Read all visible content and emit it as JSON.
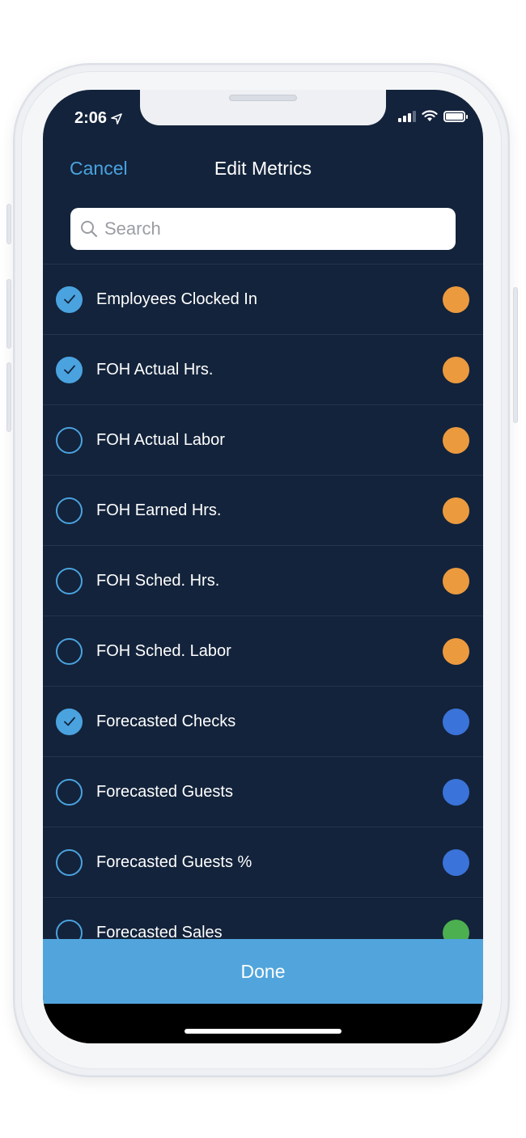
{
  "status_bar": {
    "time": "2:06"
  },
  "nav": {
    "cancel_label": "Cancel",
    "title": "Edit Metrics"
  },
  "search": {
    "placeholder": "Search",
    "value": ""
  },
  "metrics": [
    {
      "label": "Employees Clocked In",
      "checked": true,
      "color": "#ec9a3e"
    },
    {
      "label": "FOH Actual Hrs.",
      "checked": true,
      "color": "#ec9a3e"
    },
    {
      "label": "FOH Actual Labor",
      "checked": false,
      "color": "#ec9a3e"
    },
    {
      "label": "FOH Earned Hrs.",
      "checked": false,
      "color": "#ec9a3e"
    },
    {
      "label": "FOH Sched. Hrs.",
      "checked": false,
      "color": "#ec9a3e"
    },
    {
      "label": "FOH Sched. Labor",
      "checked": false,
      "color": "#ec9a3e"
    },
    {
      "label": "Forecasted Checks",
      "checked": true,
      "color": "#3a73d9"
    },
    {
      "label": "Forecasted Guests",
      "checked": false,
      "color": "#3a73d9"
    },
    {
      "label": "Forecasted Guests %",
      "checked": false,
      "color": "#3a73d9"
    },
    {
      "label": "Forecasted Sales",
      "checked": false,
      "color": "#4caf50"
    }
  ],
  "footer": {
    "done_label": "Done"
  },
  "colors": {
    "background": "#13233b",
    "accent": "#4aa3df",
    "done_button": "#51a5dc"
  }
}
